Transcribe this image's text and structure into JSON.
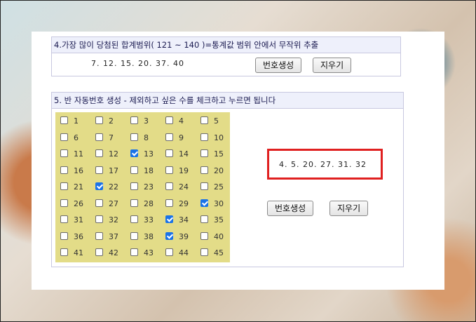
{
  "section4": {
    "title": "4.가장 많이 당첨된 합계범위( 121 ~ 140 )=통계값 범위 안에서 무작위 추출",
    "numbers": "7. 12. 15. 20. 37. 40",
    "generate_label": "번호생성",
    "clear_label": "지우기"
  },
  "section5": {
    "title": "5. 반 자동번호 생성 - 제외하고 싶은 수를 체크하고 누르면 됩니다",
    "checked": [
      13,
      22,
      30,
      34,
      39
    ],
    "numbers": [
      "1",
      "2",
      "3",
      "4",
      "5",
      "6",
      "7",
      "8",
      "9",
      "10",
      "11",
      "12",
      "13",
      "14",
      "15",
      "16",
      "17",
      "18",
      "19",
      "20",
      "21",
      "22",
      "23",
      "24",
      "25",
      "26",
      "27",
      "28",
      "29",
      "30",
      "31",
      "32",
      "33",
      "34",
      "35",
      "36",
      "37",
      "38",
      "39",
      "40",
      "41",
      "42",
      "43",
      "44",
      "45"
    ],
    "result": "4. 5. 20. 27. 31. 32",
    "generate_label": "번호생성",
    "clear_label": "지우기"
  },
  "colors": {
    "header_bg": "#eef0fb",
    "grid_bg": "#e3dc88",
    "highlight_border": "#e02020",
    "checkbox_checked": "#1a73e8"
  }
}
